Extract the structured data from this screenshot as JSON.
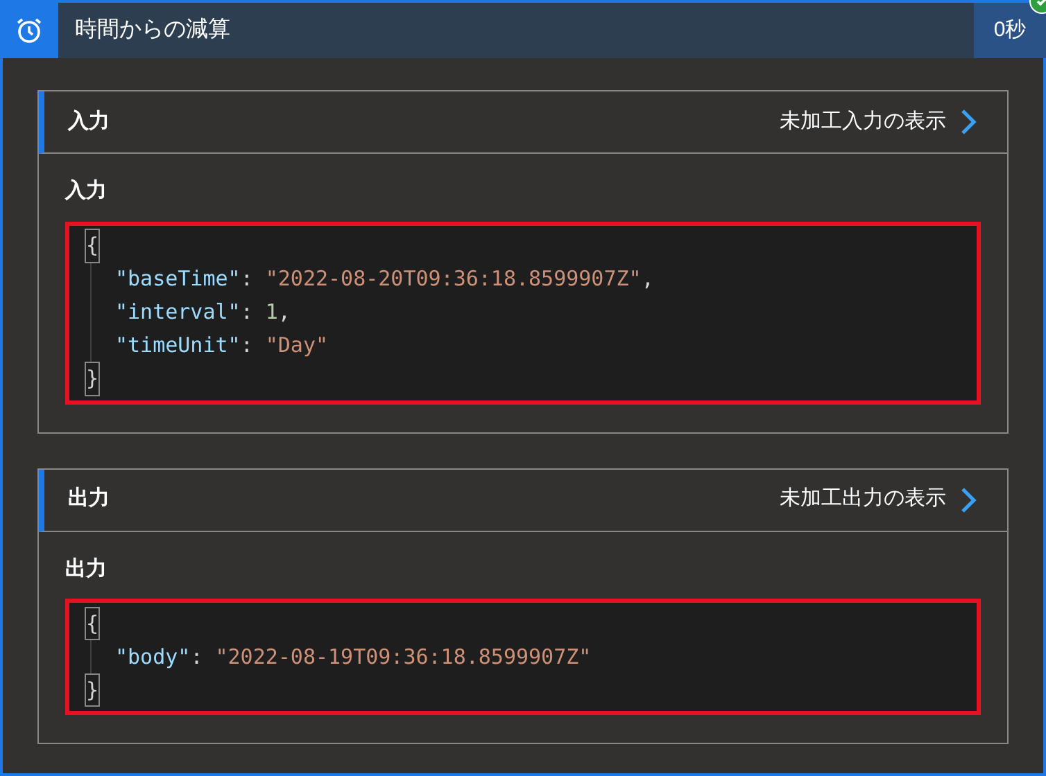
{
  "header": {
    "title": "時間からの減算",
    "duration": "0秒",
    "succeeded": true
  },
  "sections": [
    {
      "title": "入力",
      "link": "未加工入力の表示",
      "label": "入力",
      "highlighted": true,
      "code": [
        {
          "kind": "brace",
          "tokens": [
            {
              "kind": "punct",
              "text": "{"
            }
          ]
        },
        {
          "kind": "entry",
          "tokens": [
            {
              "kind": "key",
              "text": "\"baseTime\""
            },
            {
              "kind": "punct",
              "text": ": "
            },
            {
              "kind": "string",
              "text": "\"2022-08-20T09:36:18.8599907Z\""
            },
            {
              "kind": "punct",
              "text": ","
            }
          ]
        },
        {
          "kind": "entry",
          "tokens": [
            {
              "kind": "key",
              "text": "\"interval\""
            },
            {
              "kind": "punct",
              "text": ": "
            },
            {
              "kind": "number",
              "text": "1"
            },
            {
              "kind": "punct",
              "text": ","
            }
          ]
        },
        {
          "kind": "entry",
          "tokens": [
            {
              "kind": "key",
              "text": "\"timeUnit\""
            },
            {
              "kind": "punct",
              "text": ": "
            },
            {
              "kind": "string",
              "text": "\"Day\""
            }
          ]
        },
        {
          "kind": "brace",
          "tokens": [
            {
              "kind": "punct",
              "text": "}"
            }
          ]
        }
      ]
    },
    {
      "title": "出力",
      "link": "未加工出力の表示",
      "label": "出力",
      "highlighted": true,
      "code": [
        {
          "kind": "brace",
          "tokens": [
            {
              "kind": "punct",
              "text": "{"
            }
          ]
        },
        {
          "kind": "entry",
          "tokens": [
            {
              "kind": "key",
              "text": "\"body\""
            },
            {
              "kind": "punct",
              "text": ": "
            },
            {
              "kind": "string",
              "text": "\"2022-08-19T09:36:18.8599907Z\""
            }
          ]
        },
        {
          "kind": "brace",
          "tokens": [
            {
              "kind": "punct",
              "text": "}"
            }
          ]
        }
      ]
    }
  ]
}
